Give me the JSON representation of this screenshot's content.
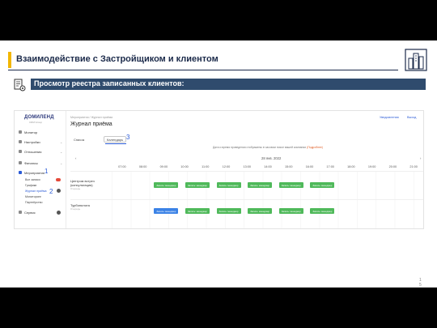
{
  "slide": {
    "title": "Взаимодействие с Застройщиком и клиентом",
    "section_title": "Просмотр реестра записанных клиентов:",
    "page_number": "1\n5"
  },
  "colors": {
    "accent": "#f2b600",
    "band": "#2f4b6d",
    "navy": "#1b2a4a",
    "link": "#2b5bd6",
    "slot_green": "#4fb95a",
    "slot_blue": "#3b82e6"
  },
  "icons": {
    "logo": "buildings-logo-icon",
    "section": "document-gear-icon"
  },
  "app": {
    "brand": "ДОМИЛЕНД",
    "brand_sub": "CRM Group",
    "sidebar": {
      "items": [
        {
          "label": "Монитор",
          "icon": "monitor-icon"
        },
        {
          "label": "Настройки",
          "icon": "settings-icon"
        },
        {
          "label": "Отношения",
          "icon": "relations-icon"
        },
        {
          "label": "Финансы",
          "icon": "finance-icon"
        },
        {
          "label": "Мероприятия",
          "icon": "events-icon"
        }
      ],
      "sub_items": [
        "Все записи",
        "Графики",
        "Журнал приёма",
        "Мониторинг",
        "Партнёрство"
      ],
      "last_item": {
        "label": "Сервис",
        "icon": "service-icon"
      }
    },
    "callouts": [
      "1",
      "2",
      "3"
    ],
    "breadcrumb": "Мероприятия / Журнал приёма",
    "page_heading": "Журнал приёма",
    "top_links": [
      "Уведомления",
      "Выход"
    ],
    "tabs": [
      "Список",
      "Календарь"
    ],
    "hint_text": "Дата и время проведения отображены в часовом поясе вашей компании",
    "hint_link": "(Подробнее)",
    "date_nav": {
      "prev": "‹",
      "date": "28 янв. 2022",
      "next": "›"
    },
    "times": [
      "07:00",
      "08:00",
      "09:00",
      "10:00",
      "11:00",
      "12:00",
      "13:00",
      "14:00",
      "15:00",
      "16:00",
      "17:00",
      "18:00",
      "19:00",
      "20:00",
      "21:00"
    ],
    "rooms": [
      {
        "name": "Центром встреч",
        "name2": "(консультация)",
        "sub": "Очередь"
      },
      {
        "name": "Турбопилота",
        "name2": "",
        "sub": "Очередь"
      }
    ],
    "slot_label": "Запись: менеджер",
    "slots": [
      {
        "row": 0,
        "hour": 9,
        "color": "green"
      },
      {
        "row": 0,
        "hour": 10.5,
        "color": "green"
      },
      {
        "row": 0,
        "hour": 12,
        "color": "green"
      },
      {
        "row": 0,
        "hour": 13.5,
        "color": "green"
      },
      {
        "row": 0,
        "hour": 15,
        "color": "green"
      },
      {
        "row": 0,
        "hour": 16.5,
        "color": "green"
      },
      {
        "row": 1,
        "hour": 9,
        "color": "blue"
      },
      {
        "row": 1,
        "hour": 10.5,
        "color": "green"
      },
      {
        "row": 1,
        "hour": 12,
        "color": "green"
      },
      {
        "row": 1,
        "hour": 13.5,
        "color": "green"
      },
      {
        "row": 1,
        "hour": 15,
        "color": "green"
      },
      {
        "row": 1,
        "hour": 16.5,
        "color": "green"
      }
    ]
  }
}
